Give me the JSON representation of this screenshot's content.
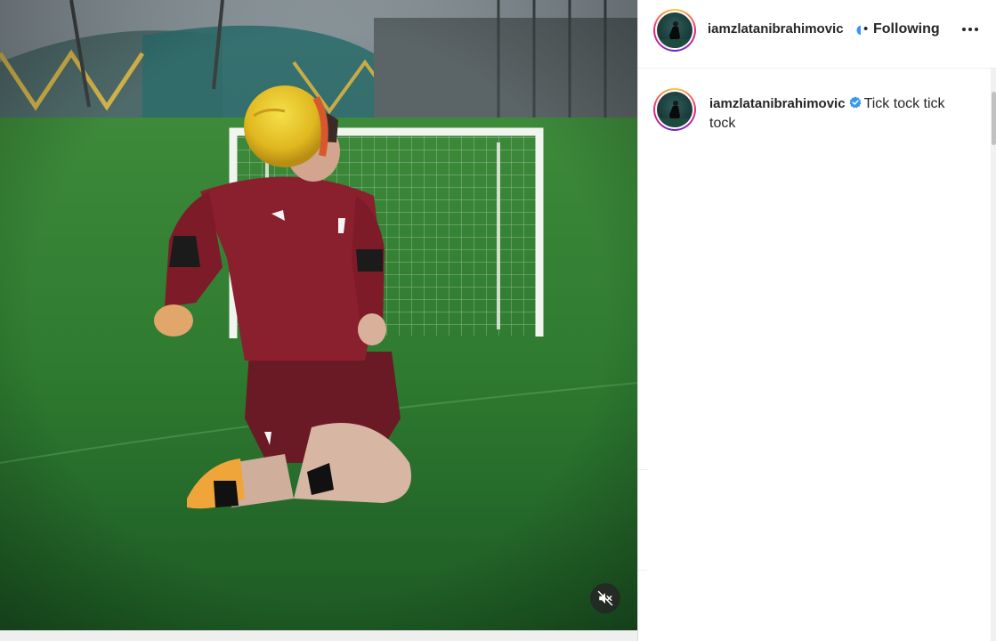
{
  "post": {
    "author": {
      "username": "iamzlatanibrahimovic",
      "verified": true
    },
    "header": {
      "separator": "•",
      "follow_label": "Following",
      "more_icon": "more-horizontal-icon"
    },
    "caption": {
      "username": "iamzlatanibrahimovic",
      "text": "Tick tock tick tock"
    },
    "media": {
      "type": "video",
      "mute_icon": "speaker-muted-icon"
    }
  },
  "colors": {
    "text": "#262626",
    "verified_badge": "#3897f0",
    "avatar_ring_start": "#f9ce34",
    "avatar_ring_mid": "#ee2a7b",
    "mute_button_bg": "#262626"
  }
}
